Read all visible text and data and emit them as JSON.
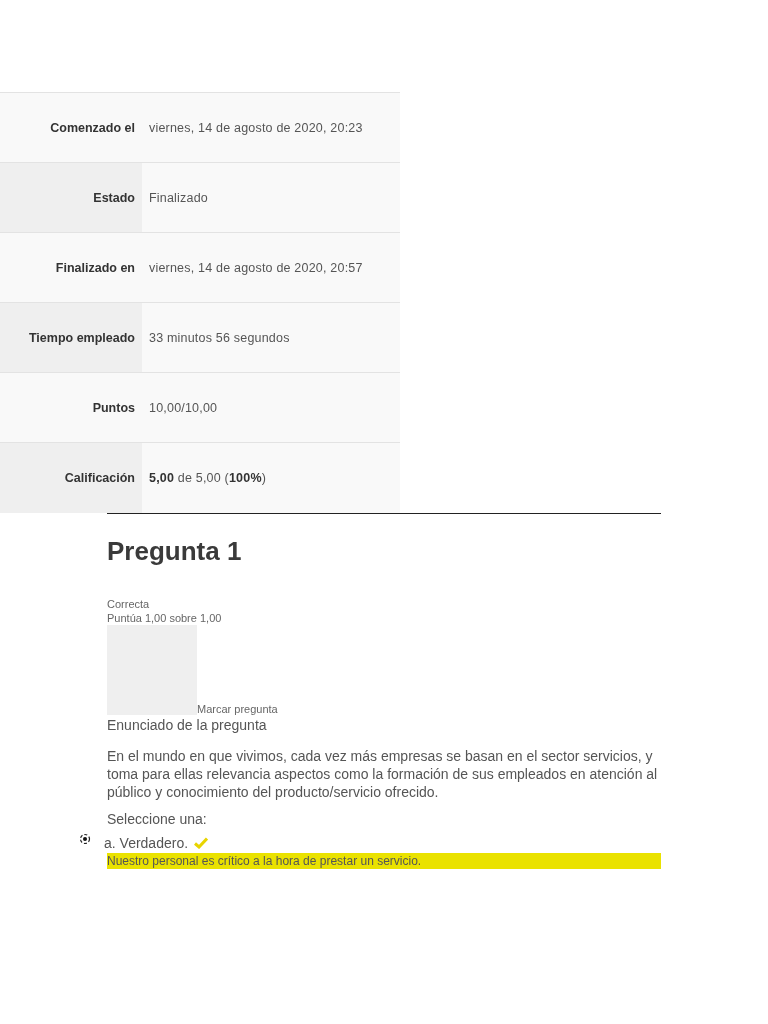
{
  "summary": [
    {
      "label": "Comenzado el",
      "value": "viernes, 14 de agosto de 2020, 20:23"
    },
    {
      "label": "Estado",
      "value": "Finalizado"
    },
    {
      "label": "Finalizado en",
      "value": "viernes, 14 de agosto de 2020, 20:57"
    },
    {
      "label": "Tiempo empleado",
      "value": "33 minutos 56 segundos"
    },
    {
      "label": "Puntos",
      "value": "10,00/10,00"
    },
    {
      "label": "Calificación",
      "value": "**5,00** de 5,00 (**100%**)"
    }
  ],
  "question": {
    "title": "Pregunta 1",
    "status": "Correcta",
    "score": "Puntúa 1,00 sobre 1,00",
    "flag_label": "Marcar pregunta",
    "statement_heading": "Enunciado de la pregunta",
    "text": "En el mundo en que vivimos, cada vez más empresas se basan en el sector servicios, y toma para ellas relevancia aspectos como la formación de sus empleados en atención al público y conocimiento del producto/servicio ofrecido.",
    "prompt": "Seleccione una:",
    "options": [
      {
        "label": "a. Verdadero.",
        "selected": true,
        "correct": true
      }
    ],
    "feedback": "Nuestro personal es crítico a la hora de prestar un servicio."
  }
}
